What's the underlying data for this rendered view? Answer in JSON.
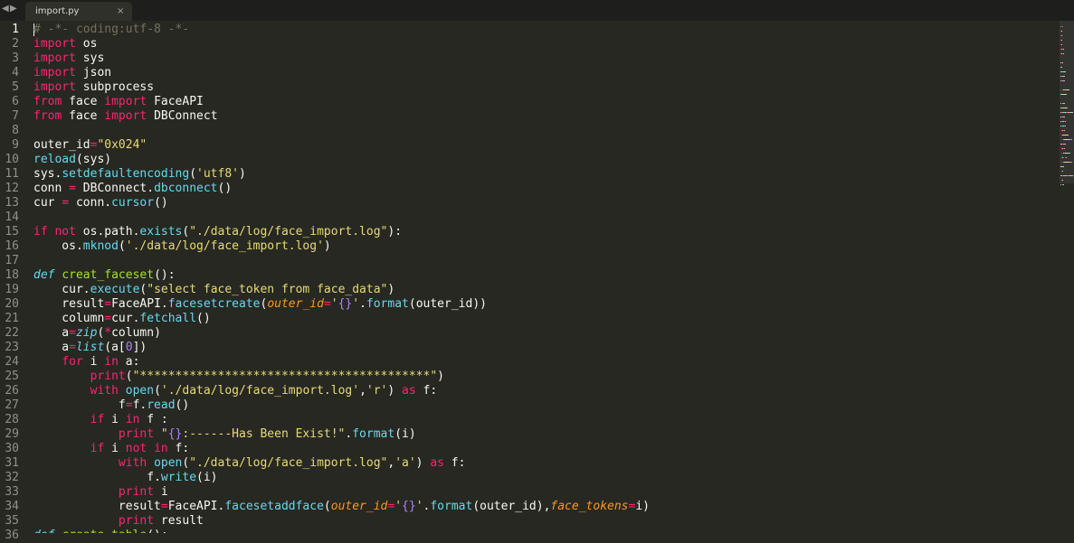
{
  "tabbar": {
    "nav_left_icon": "triangle-left",
    "nav_right_icon": "triangle-right",
    "tab": {
      "title": "import.py",
      "close_icon": "×"
    }
  },
  "editor": {
    "current_line": 1,
    "lines": [
      [
        {
          "t": "# -*- coding:utf-8 -*-",
          "c": "cm"
        }
      ],
      [
        {
          "t": "import",
          "c": "kw"
        },
        {
          "t": " os",
          "c": "pl"
        }
      ],
      [
        {
          "t": "import",
          "c": "kw"
        },
        {
          "t": " sys",
          "c": "pl"
        }
      ],
      [
        {
          "t": "import",
          "c": "kw"
        },
        {
          "t": " json",
          "c": "pl"
        }
      ],
      [
        {
          "t": "import",
          "c": "kw"
        },
        {
          "t": " subprocess",
          "c": "pl"
        }
      ],
      [
        {
          "t": "from",
          "c": "kw"
        },
        {
          "t": " face ",
          "c": "pl"
        },
        {
          "t": "import",
          "c": "kw"
        },
        {
          "t": " FaceAPI",
          "c": "pl"
        }
      ],
      [
        {
          "t": "from",
          "c": "kw"
        },
        {
          "t": " face ",
          "c": "pl"
        },
        {
          "t": "import",
          "c": "kw"
        },
        {
          "t": " DBConnect",
          "c": "pl"
        }
      ],
      [],
      [
        {
          "t": "outer_id",
          "c": "pl"
        },
        {
          "t": "=",
          "c": "kw"
        },
        {
          "t": "\"0x024\"",
          "c": "st"
        }
      ],
      [
        {
          "t": "reload",
          "c": "fn"
        },
        {
          "t": "(sys)",
          "c": "pl"
        }
      ],
      [
        {
          "t": "sys.",
          "c": "pl"
        },
        {
          "t": "setdefaultencoding",
          "c": "fn"
        },
        {
          "t": "(",
          "c": "pl"
        },
        {
          "t": "'utf8'",
          "c": "st"
        },
        {
          "t": ")",
          "c": "pl"
        }
      ],
      [
        {
          "t": "conn ",
          "c": "pl"
        },
        {
          "t": "=",
          "c": "kw"
        },
        {
          "t": " DBConnect.",
          "c": "pl"
        },
        {
          "t": "dbconnect",
          "c": "fn"
        },
        {
          "t": "()",
          "c": "pl"
        }
      ],
      [
        {
          "t": "cur ",
          "c": "pl"
        },
        {
          "t": "=",
          "c": "kw"
        },
        {
          "t": " conn.",
          "c": "pl"
        },
        {
          "t": "cursor",
          "c": "fn"
        },
        {
          "t": "()",
          "c": "pl"
        }
      ],
      [],
      [
        {
          "t": "if",
          "c": "kw"
        },
        {
          "t": " ",
          "c": "pl"
        },
        {
          "t": "not",
          "c": "kw"
        },
        {
          "t": " os.path.",
          "c": "pl"
        },
        {
          "t": "exists",
          "c": "fn"
        },
        {
          "t": "(",
          "c": "pl"
        },
        {
          "t": "\"./data/log/face_import.log\"",
          "c": "st"
        },
        {
          "t": "):",
          "c": "pl"
        }
      ],
      [
        {
          "t": "    os.",
          "c": "pl"
        },
        {
          "t": "mknod",
          "c": "fn"
        },
        {
          "t": "(",
          "c": "pl"
        },
        {
          "t": "'./data/log/face_import.log'",
          "c": "st"
        },
        {
          "t": ")",
          "c": "pl"
        }
      ],
      [],
      [
        {
          "t": "def",
          "c": "fn it"
        },
        {
          "t": " ",
          "c": "pl"
        },
        {
          "t": "creat_faceset",
          "c": "df"
        },
        {
          "t": "():",
          "c": "pl"
        }
      ],
      [
        {
          "t": "    cur.",
          "c": "pl"
        },
        {
          "t": "execute",
          "c": "fn"
        },
        {
          "t": "(",
          "c": "pl"
        },
        {
          "t": "\"select face_token from face_data\"",
          "c": "st"
        },
        {
          "t": ")",
          "c": "pl"
        }
      ],
      [
        {
          "t": "    result",
          "c": "pl"
        },
        {
          "t": "=",
          "c": "kw"
        },
        {
          "t": "FaceAPI.",
          "c": "pl"
        },
        {
          "t": "facesetcreate",
          "c": "fn"
        },
        {
          "t": "(",
          "c": "pl"
        },
        {
          "t": "outer_id",
          "c": "ar"
        },
        {
          "t": "=",
          "c": "kw"
        },
        {
          "t": "'",
          "c": "st"
        },
        {
          "t": "{}",
          "c": "nm"
        },
        {
          "t": "'",
          "c": "st"
        },
        {
          "t": ".",
          "c": "pl"
        },
        {
          "t": "format",
          "c": "fn"
        },
        {
          "t": "(outer_id))",
          "c": "pl"
        }
      ],
      [
        {
          "t": "    column",
          "c": "pl"
        },
        {
          "t": "=",
          "c": "kw"
        },
        {
          "t": "cur.",
          "c": "pl"
        },
        {
          "t": "fetchall",
          "c": "fn"
        },
        {
          "t": "()",
          "c": "pl"
        }
      ],
      [
        {
          "t": "    a",
          "c": "pl"
        },
        {
          "t": "=",
          "c": "kw"
        },
        {
          "t": "zip",
          "c": "fn it"
        },
        {
          "t": "(",
          "c": "pl"
        },
        {
          "t": "*",
          "c": "kw"
        },
        {
          "t": "column)",
          "c": "pl"
        }
      ],
      [
        {
          "t": "    a",
          "c": "pl"
        },
        {
          "t": "=",
          "c": "kw"
        },
        {
          "t": "list",
          "c": "fn it"
        },
        {
          "t": "(a[",
          "c": "pl"
        },
        {
          "t": "0",
          "c": "nm"
        },
        {
          "t": "])",
          "c": "pl"
        }
      ],
      [
        {
          "t": "    ",
          "c": "pl"
        },
        {
          "t": "for",
          "c": "kw"
        },
        {
          "t": " i ",
          "c": "pl"
        },
        {
          "t": "in",
          "c": "kw"
        },
        {
          "t": " a:",
          "c": "pl"
        }
      ],
      [
        {
          "t": "        ",
          "c": "pl"
        },
        {
          "t": "print",
          "c": "kw"
        },
        {
          "t": "(",
          "c": "pl"
        },
        {
          "t": "\"*****************************************\"",
          "c": "st"
        },
        {
          "t": ")",
          "c": "pl"
        }
      ],
      [
        {
          "t": "        ",
          "c": "pl"
        },
        {
          "t": "with",
          "c": "kw"
        },
        {
          "t": " ",
          "c": "pl"
        },
        {
          "t": "open",
          "c": "fn"
        },
        {
          "t": "(",
          "c": "pl"
        },
        {
          "t": "'./data/log/face_import.log'",
          "c": "st"
        },
        {
          "t": ",",
          "c": "pl"
        },
        {
          "t": "'r'",
          "c": "st"
        },
        {
          "t": ") ",
          "c": "pl"
        },
        {
          "t": "as",
          "c": "kw"
        },
        {
          "t": " f:",
          "c": "pl"
        }
      ],
      [
        {
          "t": "            f",
          "c": "pl"
        },
        {
          "t": "=",
          "c": "kw"
        },
        {
          "t": "f.",
          "c": "pl"
        },
        {
          "t": "read",
          "c": "fn"
        },
        {
          "t": "()",
          "c": "pl"
        }
      ],
      [
        {
          "t": "        ",
          "c": "pl"
        },
        {
          "t": "if",
          "c": "kw"
        },
        {
          "t": " i ",
          "c": "pl"
        },
        {
          "t": "in",
          "c": "kw"
        },
        {
          "t": " f :",
          "c": "pl"
        }
      ],
      [
        {
          "t": "            ",
          "c": "pl"
        },
        {
          "t": "print",
          "c": "kw"
        },
        {
          "t": " ",
          "c": "pl"
        },
        {
          "t": "\"",
          "c": "st"
        },
        {
          "t": "{}",
          "c": "nm"
        },
        {
          "t": ":------Has Been Exist!\"",
          "c": "st"
        },
        {
          "t": ".",
          "c": "pl"
        },
        {
          "t": "format",
          "c": "fn"
        },
        {
          "t": "(i)",
          "c": "pl"
        }
      ],
      [
        {
          "t": "        ",
          "c": "pl"
        },
        {
          "t": "if",
          "c": "kw"
        },
        {
          "t": " i ",
          "c": "pl"
        },
        {
          "t": "not",
          "c": "kw"
        },
        {
          "t": " ",
          "c": "pl"
        },
        {
          "t": "in",
          "c": "kw"
        },
        {
          "t": " f:",
          "c": "pl"
        }
      ],
      [
        {
          "t": "            ",
          "c": "pl"
        },
        {
          "t": "with",
          "c": "kw"
        },
        {
          "t": " ",
          "c": "pl"
        },
        {
          "t": "open",
          "c": "fn"
        },
        {
          "t": "(",
          "c": "pl"
        },
        {
          "t": "\"./data/log/face_import.log\"",
          "c": "st"
        },
        {
          "t": ",",
          "c": "pl"
        },
        {
          "t": "'a'",
          "c": "st"
        },
        {
          "t": ") ",
          "c": "pl"
        },
        {
          "t": "as",
          "c": "kw"
        },
        {
          "t": " f:",
          "c": "pl"
        }
      ],
      [
        {
          "t": "                f.",
          "c": "pl"
        },
        {
          "t": "write",
          "c": "fn"
        },
        {
          "t": "(i)",
          "c": "pl"
        }
      ],
      [
        {
          "t": "            ",
          "c": "pl"
        },
        {
          "t": "print",
          "c": "kw"
        },
        {
          "t": " i",
          "c": "pl"
        }
      ],
      [
        {
          "t": "            result",
          "c": "pl"
        },
        {
          "t": "=",
          "c": "kw"
        },
        {
          "t": "FaceAPI.",
          "c": "pl"
        },
        {
          "t": "facesetaddface",
          "c": "fn"
        },
        {
          "t": "(",
          "c": "pl"
        },
        {
          "t": "outer_id",
          "c": "ar"
        },
        {
          "t": "=",
          "c": "kw"
        },
        {
          "t": "'",
          "c": "st"
        },
        {
          "t": "{}",
          "c": "nm"
        },
        {
          "t": "'",
          "c": "st"
        },
        {
          "t": ".",
          "c": "pl"
        },
        {
          "t": "format",
          "c": "fn"
        },
        {
          "t": "(outer_id),",
          "c": "pl"
        },
        {
          "t": "face_tokens",
          "c": "ar"
        },
        {
          "t": "=",
          "c": "kw"
        },
        {
          "t": "i)",
          "c": "pl"
        }
      ],
      [
        {
          "t": "            ",
          "c": "pl"
        },
        {
          "t": "print",
          "c": "kw"
        },
        {
          "t": " result",
          "c": "pl"
        }
      ],
      [
        {
          "t": "def",
          "c": "fn it"
        },
        {
          "t": " ",
          "c": "pl"
        },
        {
          "t": "create_table",
          "c": "df"
        },
        {
          "t": "():",
          "c": "pl"
        }
      ]
    ]
  },
  "colors": {
    "background": "#272822",
    "tabbar": "#1e1f1c",
    "keyword": "#f92672",
    "string": "#e6db74",
    "builtin": "#66d9ef",
    "number": "#ae81ff",
    "comment": "#75715e",
    "function_name": "#a6e22e",
    "argument": "#fd971f"
  }
}
